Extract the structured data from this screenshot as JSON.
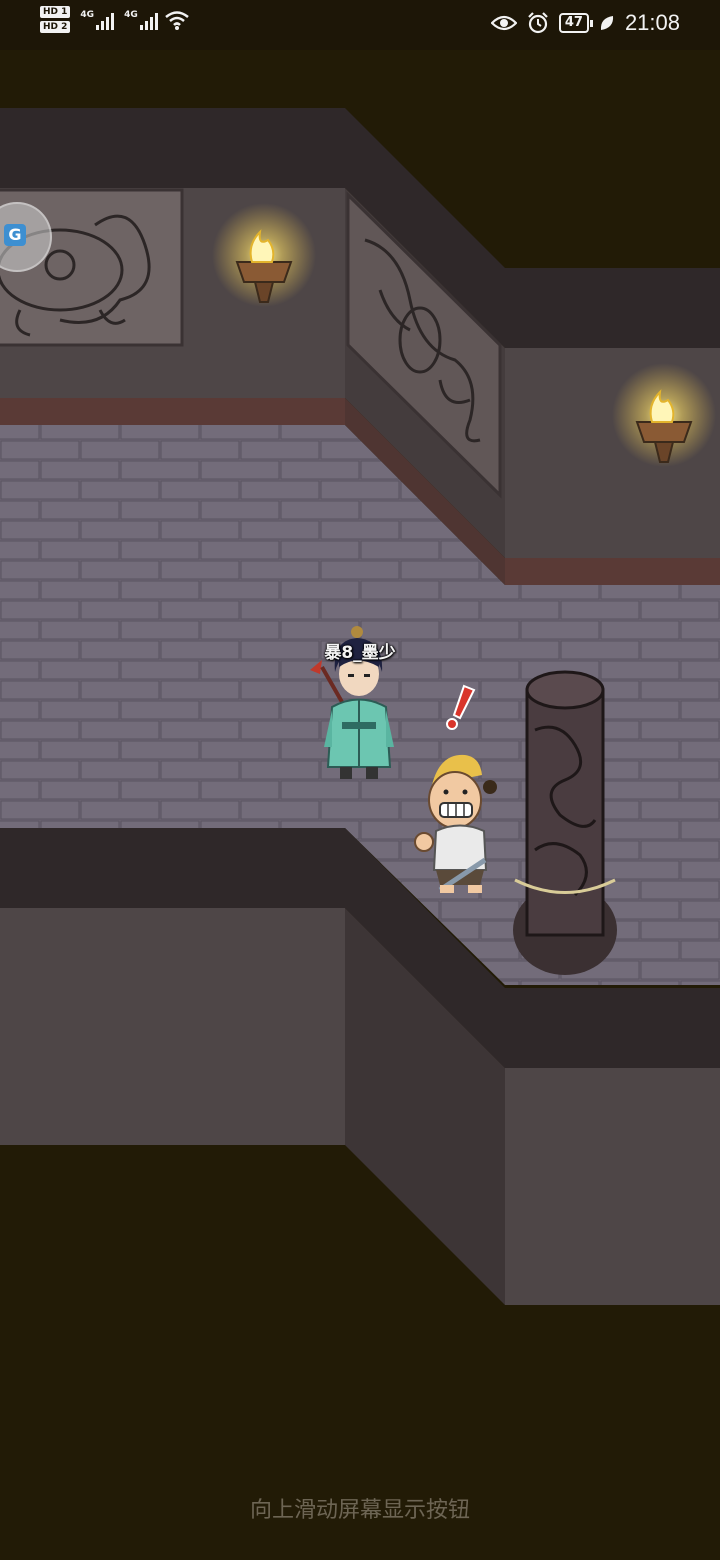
{
  "status_bar": {
    "hd1": "HD 1",
    "hd2": "HD 2",
    "net1": "4G",
    "net2": "4G",
    "battery": "47",
    "time": "21:08"
  },
  "player": {
    "name": "暴8_墨少"
  },
  "enemy": {
    "alert": "!"
  },
  "floating_button": {
    "icon": "app-switch-icon",
    "glyph": "G"
  },
  "bottom_hint": "向上滑动屏幕显示按钮",
  "colors": {
    "void": "#221b06",
    "wall_face": "#4d4546",
    "wall_top": "#3a3233",
    "floor_brick": "#6b6470",
    "torch_glow": "#ffe97a"
  }
}
